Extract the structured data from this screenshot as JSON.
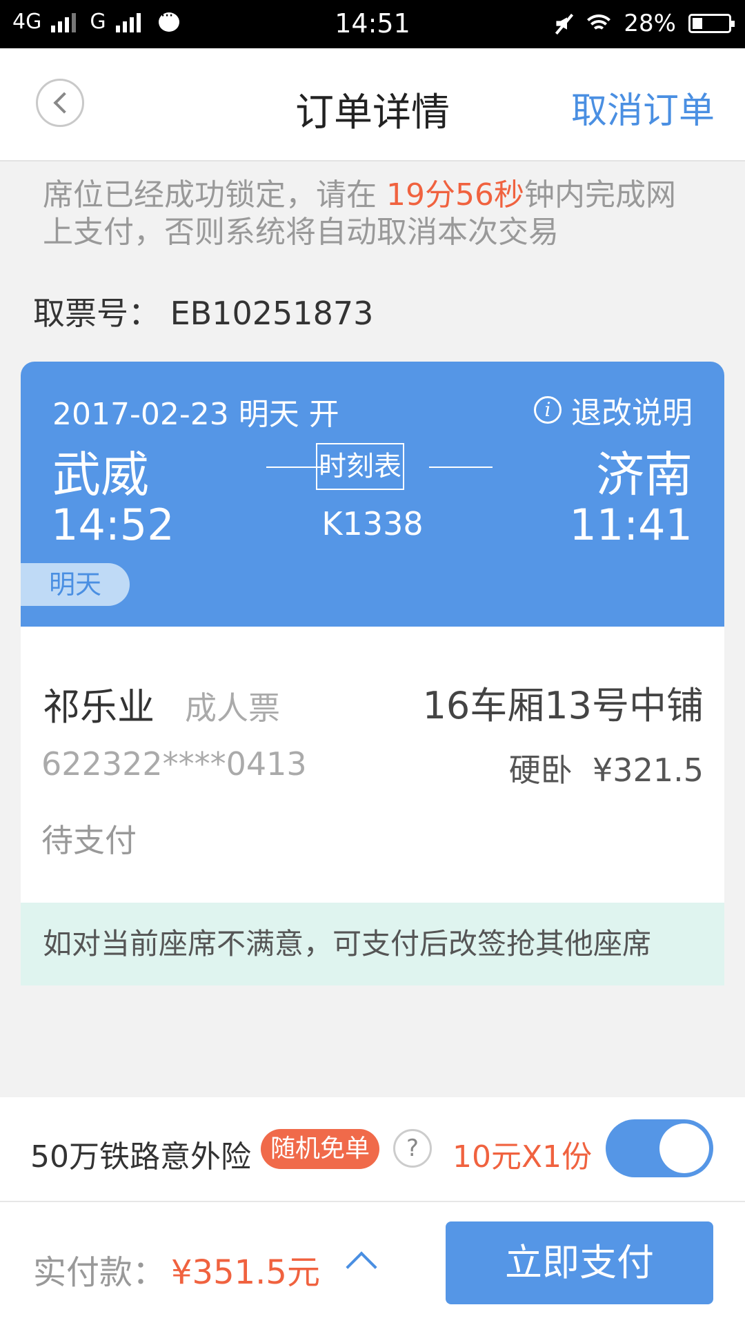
{
  "status_bar": {
    "network1": "4G",
    "network2": "G",
    "time": "14:51",
    "battery_text": "28%",
    "battery_level": 0.28
  },
  "header": {
    "title": "订单详情",
    "cancel_label": "取消订单"
  },
  "notice": {
    "part1": "席位已经成功锁定，请在 ",
    "countdown": "19分56秒",
    "part2": "钟内完成网上支付，否则系统将自动取消本次交易"
  },
  "ticket_no": "取票号： EB10251873",
  "trip": {
    "date_line": "2017-02-23 明天 开",
    "refund_info": "退改说明",
    "from_station": "武威",
    "to_station": "济南",
    "schedule_label": "时刻表",
    "train_no": "K1338",
    "depart_time": "14:52",
    "arrive_time": "11:41",
    "day_tag": "明天"
  },
  "passenger": {
    "name": "祁乐业",
    "ticket_type": "成人票",
    "seat": "16车厢13号中铺",
    "id_number": "622322****0413",
    "class_price": "硬卧  ¥321.5",
    "status": "待支付"
  },
  "tip": "如对当前座席不满意，可支付后改签抢其他座席",
  "insurance": {
    "label": "50万铁路意外险",
    "badge": "随机免单",
    "help": "?",
    "price": "10元X1份",
    "enabled": true
  },
  "bottom": {
    "total_label": "实付款：",
    "total_value": "¥351.5元",
    "pay_label": "立即支付"
  },
  "colors": {
    "accent": "#5596e6",
    "highlight": "#f0623f",
    "tip_bg": "#dff4ef"
  }
}
